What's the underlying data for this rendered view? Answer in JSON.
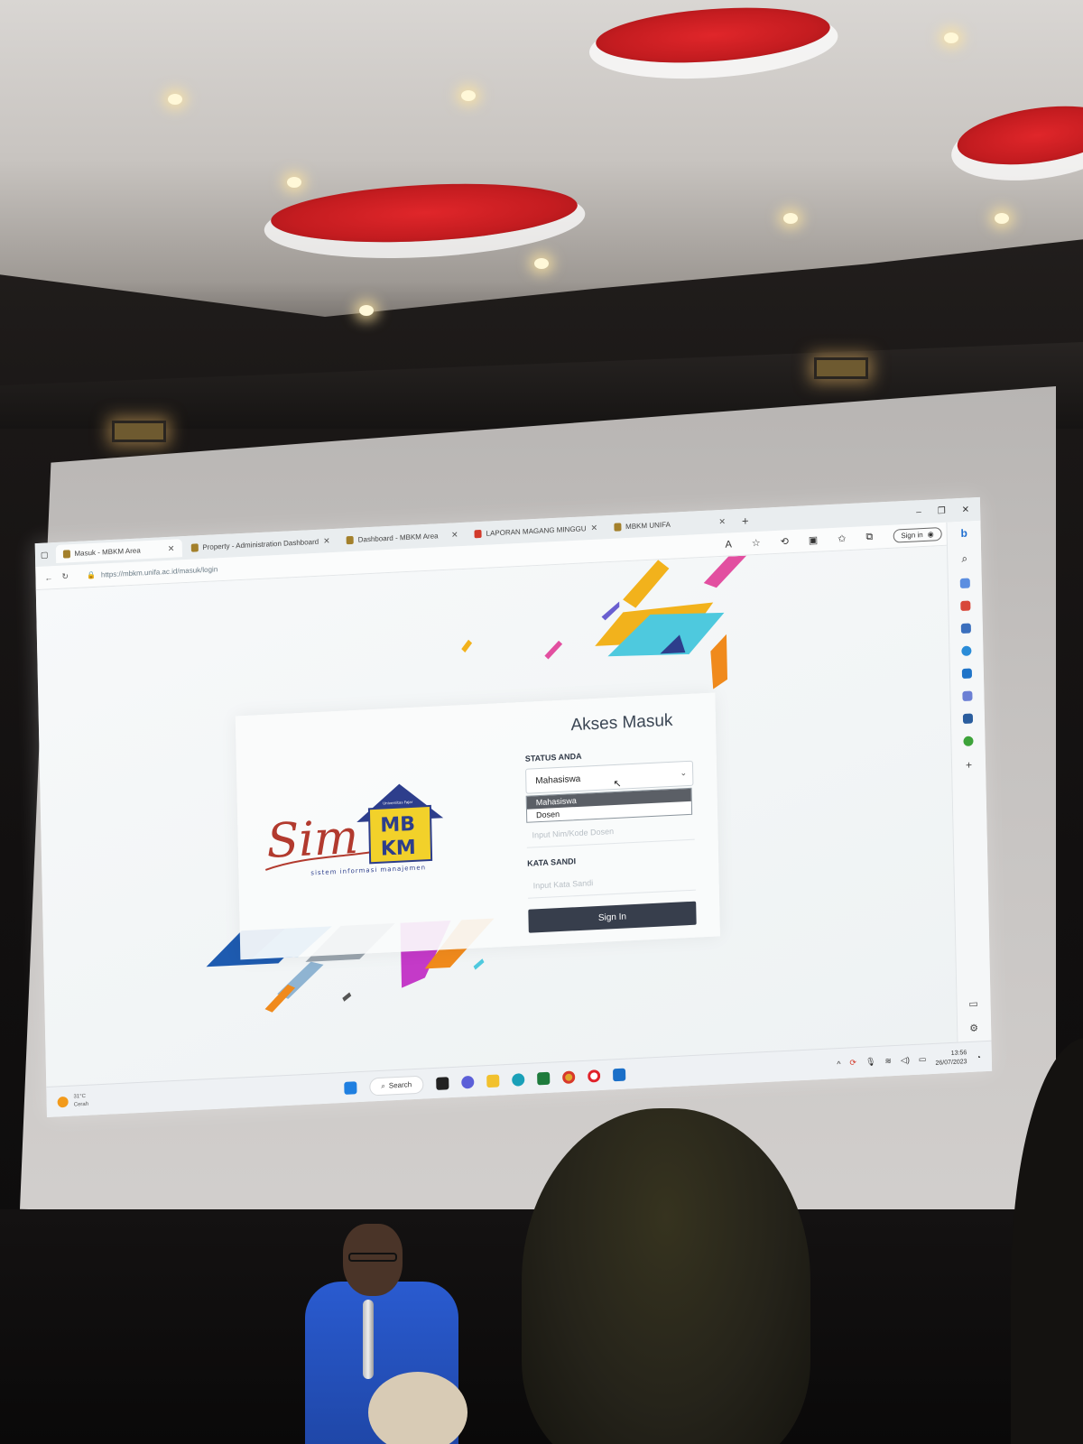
{
  "browser": {
    "tabs": [
      {
        "label": "Masuk - MBKM Area",
        "active": true
      },
      {
        "label": "Property - Administration Dashboard",
        "active": false
      },
      {
        "label": "Dashboard - MBKM Area",
        "active": false
      },
      {
        "label": "LAPORAN MAGANG MINGGU",
        "active": false,
        "icon": "pdf"
      },
      {
        "label": "MBKM UNIFA",
        "active": false
      }
    ],
    "new_tab": "+",
    "url": "https://mbkm.unifa.ac.id/masuk/login",
    "signin_label": "Sign in"
  },
  "logo": {
    "script_text": "Sim",
    "badge_top": "MB",
    "badge_bottom": "KM",
    "badge_caption": "Universitas Fajar",
    "tagline": "sistem informasi manajemen"
  },
  "form": {
    "title": "Akses Masuk",
    "status_label": "STATUS ANDA",
    "status_selected": "Mahasiswa",
    "status_options": [
      "Mahasiswa",
      "Dosen"
    ],
    "id_placeholder": "Input Nim/Kode Dosen",
    "password_label": "KATA SANDI",
    "password_placeholder": "Input Kata Sandi",
    "submit_label": "Sign In"
  },
  "taskbar": {
    "weather_temp": "31°C",
    "weather_desc": "Cerah",
    "search_label": "Search",
    "time": "13:56",
    "date": "26/07/2023"
  },
  "colors": {
    "accent_dark": "#373e4c",
    "logo_red": "#b23a2e",
    "badge_yellow": "#f2d12a",
    "badge_blue": "#2d3e8c"
  }
}
